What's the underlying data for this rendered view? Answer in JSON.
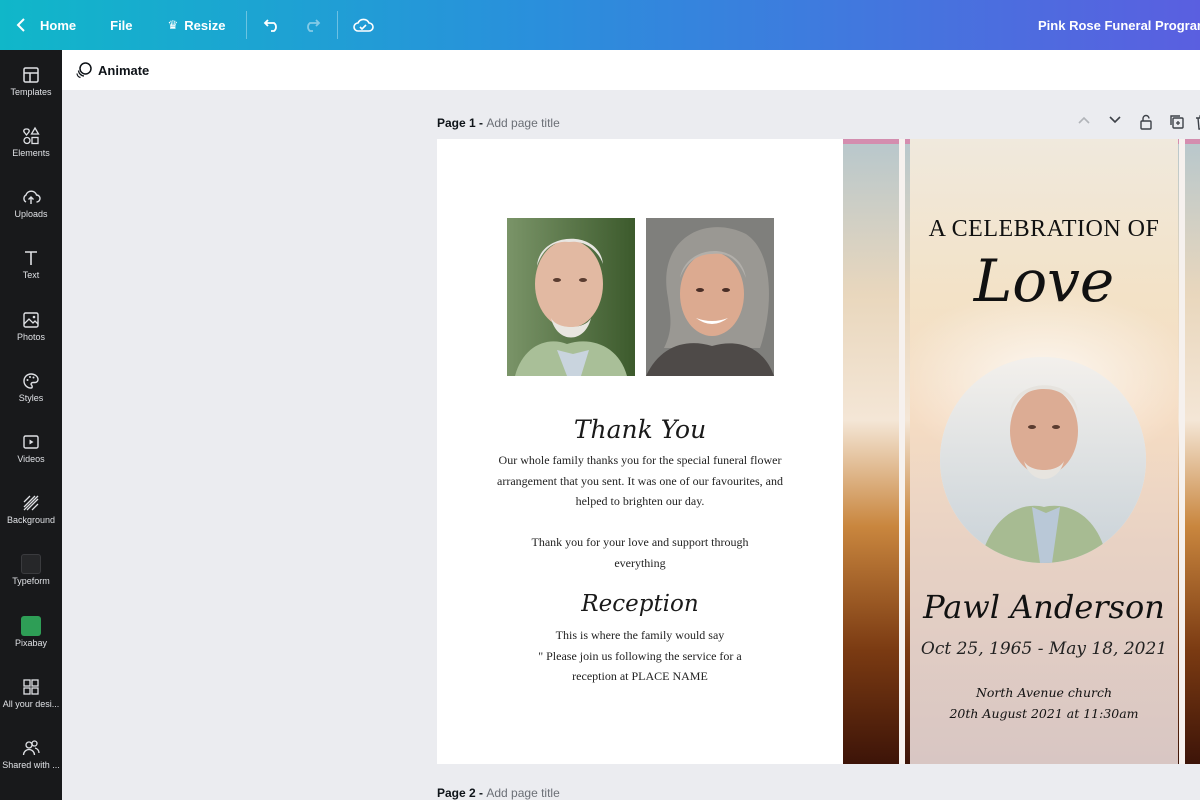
{
  "topbar": {
    "home_label": "Home",
    "file_label": "File",
    "resize_label": "Resize",
    "doc_title": "Pink Rose Funeral Program T"
  },
  "sidebar": {
    "items": [
      {
        "label": "Templates",
        "icon": "templates-icon"
      },
      {
        "label": "Elements",
        "icon": "elements-icon"
      },
      {
        "label": "Uploads",
        "icon": "upload-icon"
      },
      {
        "label": "Text",
        "icon": "text-icon"
      },
      {
        "label": "Photos",
        "icon": "photos-icon"
      },
      {
        "label": "Styles",
        "icon": "palette-icon"
      },
      {
        "label": "Videos",
        "icon": "video-icon"
      },
      {
        "label": "Background",
        "icon": "background-icon"
      },
      {
        "label": "Typeform",
        "icon": "typeform-icon"
      },
      {
        "label": "Pixabay",
        "icon": "pixabay-icon"
      },
      {
        "label": "All your desi...",
        "icon": "all-designs-icon"
      },
      {
        "label": "Shared with ...",
        "icon": "shared-icon"
      }
    ]
  },
  "animate_label": "Animate",
  "page1": {
    "title_prefix": "Page 1 - ",
    "title_placeholder": "Add page title"
  },
  "page2": {
    "title_prefix": "Page 2 - ",
    "title_placeholder": "Add page title"
  },
  "design": {
    "thank_you_heading": "Thank You",
    "thank_you_lines": [
      "Our whole family thanks you for the special funeral flower",
      "arrangement that you sent.  It was one of our favourites, and",
      "helped to brighten our day."
    ],
    "support_lines": [
      "Thank you for your love and support through",
      "everything"
    ],
    "reception_heading": "Reception",
    "reception_lines": [
      "This is where the family would say",
      "\" Please join us following the service for a",
      "reception at PLACE NAME"
    ],
    "celebration_line": "A CELEBRATION OF",
    "love_word": "Love",
    "name": "Pawl Anderson",
    "dates": "Oct 25, 1965 - May 18, 2021",
    "venue": "North Avenue church",
    "service_time": "20th August 2021 at 11:30am"
  },
  "colors": {
    "sidebar_bg": "#18191b",
    "canvas_bg": "#ebecf0",
    "topbar_gradient_start": "#10b7c9",
    "topbar_gradient_end": "#5a5fe0"
  }
}
